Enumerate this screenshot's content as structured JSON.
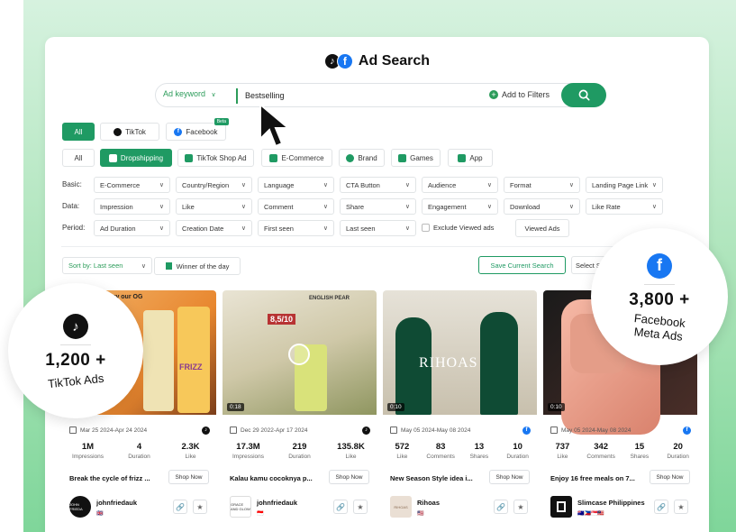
{
  "header": {
    "title": "Ad Search"
  },
  "search": {
    "keyword_type": "Ad keyword",
    "value": "Bestselling",
    "add_filters": "Add to Filters"
  },
  "platform_tabs": [
    {
      "label": "All",
      "active": true
    },
    {
      "label": "TikTok",
      "active": false
    },
    {
      "label": "Facebook",
      "active": false,
      "badge": "Beta"
    }
  ],
  "category_tabs": [
    {
      "label": "All",
      "active": false
    },
    {
      "label": "Dropshipping",
      "active": true
    },
    {
      "label": "TikTok Shop Ad",
      "active": false
    },
    {
      "label": "E-Commerce",
      "active": false
    },
    {
      "label": "Brand",
      "active": false
    },
    {
      "label": "Games",
      "active": false
    },
    {
      "label": "App",
      "active": false
    }
  ],
  "filters": {
    "basic": {
      "label": "Basic:",
      "items": [
        "E-Commerce",
        "Country/Region",
        "Language",
        "CTA Button",
        "Audience",
        "Format",
        "Landing Page Link"
      ]
    },
    "data": {
      "label": "Data:",
      "items": [
        "Impression",
        "Like",
        "Comment",
        "Share",
        "Engagement",
        "Download",
        "Like Rate"
      ]
    },
    "period": {
      "label": "Period:",
      "items": [
        "Ad Duration",
        "Creation Date",
        "First seen",
        "Last seen"
      ]
    },
    "exclude_viewed": "Exclude Viewed ads",
    "viewed_ads": "Viewed Ads"
  },
  "toolbar": {
    "sort": "Sort by: Last seen",
    "winner": "Winner of the day",
    "save_search": "Save Current Search",
    "select": "Select S"
  },
  "cards": [
    {
      "duration": "",
      "date": "Mar 25 2024-Apr 24 2024",
      "platform": "tiktok",
      "stats": [
        {
          "v": "1M",
          "l": "Impressions"
        },
        {
          "v": "4",
          "l": "Duration"
        },
        {
          "v": "2.3K",
          "l": "Like"
        }
      ],
      "headline": "Break the cycle of frizz ...",
      "shop": "Shop Now",
      "advertiser": "johnfriedauk",
      "flag": "🇬🇧",
      "media_text": "you try our OG",
      "media_sub": "FRIZZ",
      "avatar_text": "JOHN FRIEDA"
    },
    {
      "duration": "0:18",
      "date": "Dec 29 2022-Apr 17 2024",
      "platform": "tiktok",
      "stats": [
        {
          "v": "17.3M",
          "l": "Impressions"
        },
        {
          "v": "219",
          "l": "Duration"
        },
        {
          "v": "135.8K",
          "l": "Like"
        }
      ],
      "headline": "Kalau kamu cocoknya p...",
      "shop": "Shop Now",
      "advertiser": "johnfriedauk",
      "flag": "🇮🇩",
      "media_text": "ENGLISH PEAR",
      "media_sub": "8,5/10",
      "avatar_text": "GRACE AND GLOW"
    },
    {
      "duration": "0:10",
      "date": "May 05 2024-May 08 2024",
      "platform": "facebook",
      "stats": [
        {
          "v": "572",
          "l": "Like"
        },
        {
          "v": "83",
          "l": "Comments"
        },
        {
          "v": "13",
          "l": "Shares"
        },
        {
          "v": "10",
          "l": "Duration"
        }
      ],
      "headline": "New Season Style idea i...",
      "shop": "Shop Now",
      "advertiser": "Rihoas",
      "flag": "🇺🇸",
      "media_text": "RIHOAS",
      "media_sub": "",
      "avatar_text": "RIHOAS"
    },
    {
      "duration": "0:10",
      "date": "May 05 2024-May 08 2024",
      "platform": "facebook",
      "stats": [
        {
          "v": "737",
          "l": "Like"
        },
        {
          "v": "342",
          "l": "Comments"
        },
        {
          "v": "15",
          "l": "Shares"
        },
        {
          "v": "20",
          "l": "Duration"
        }
      ],
      "headline": "Enjoy 16 free meals on 7...",
      "shop": "Shop Now",
      "advertiser": "Slimcase Philippines",
      "flag": "🇦🇺🇵🇭🇸🇬🇲🇾",
      "media_text": "",
      "media_sub": "",
      "avatar_text": ""
    }
  ],
  "bubbles": {
    "tiktok": {
      "count": "1,200 +",
      "label": "TikTok Ads"
    },
    "facebook": {
      "count": "3,800 +",
      "label_1": "Facebook",
      "label_2": "Meta Ads"
    }
  },
  "colors": {
    "accent": "#1f9a63",
    "facebook": "#1877f2",
    "tiktok": "#111111"
  }
}
